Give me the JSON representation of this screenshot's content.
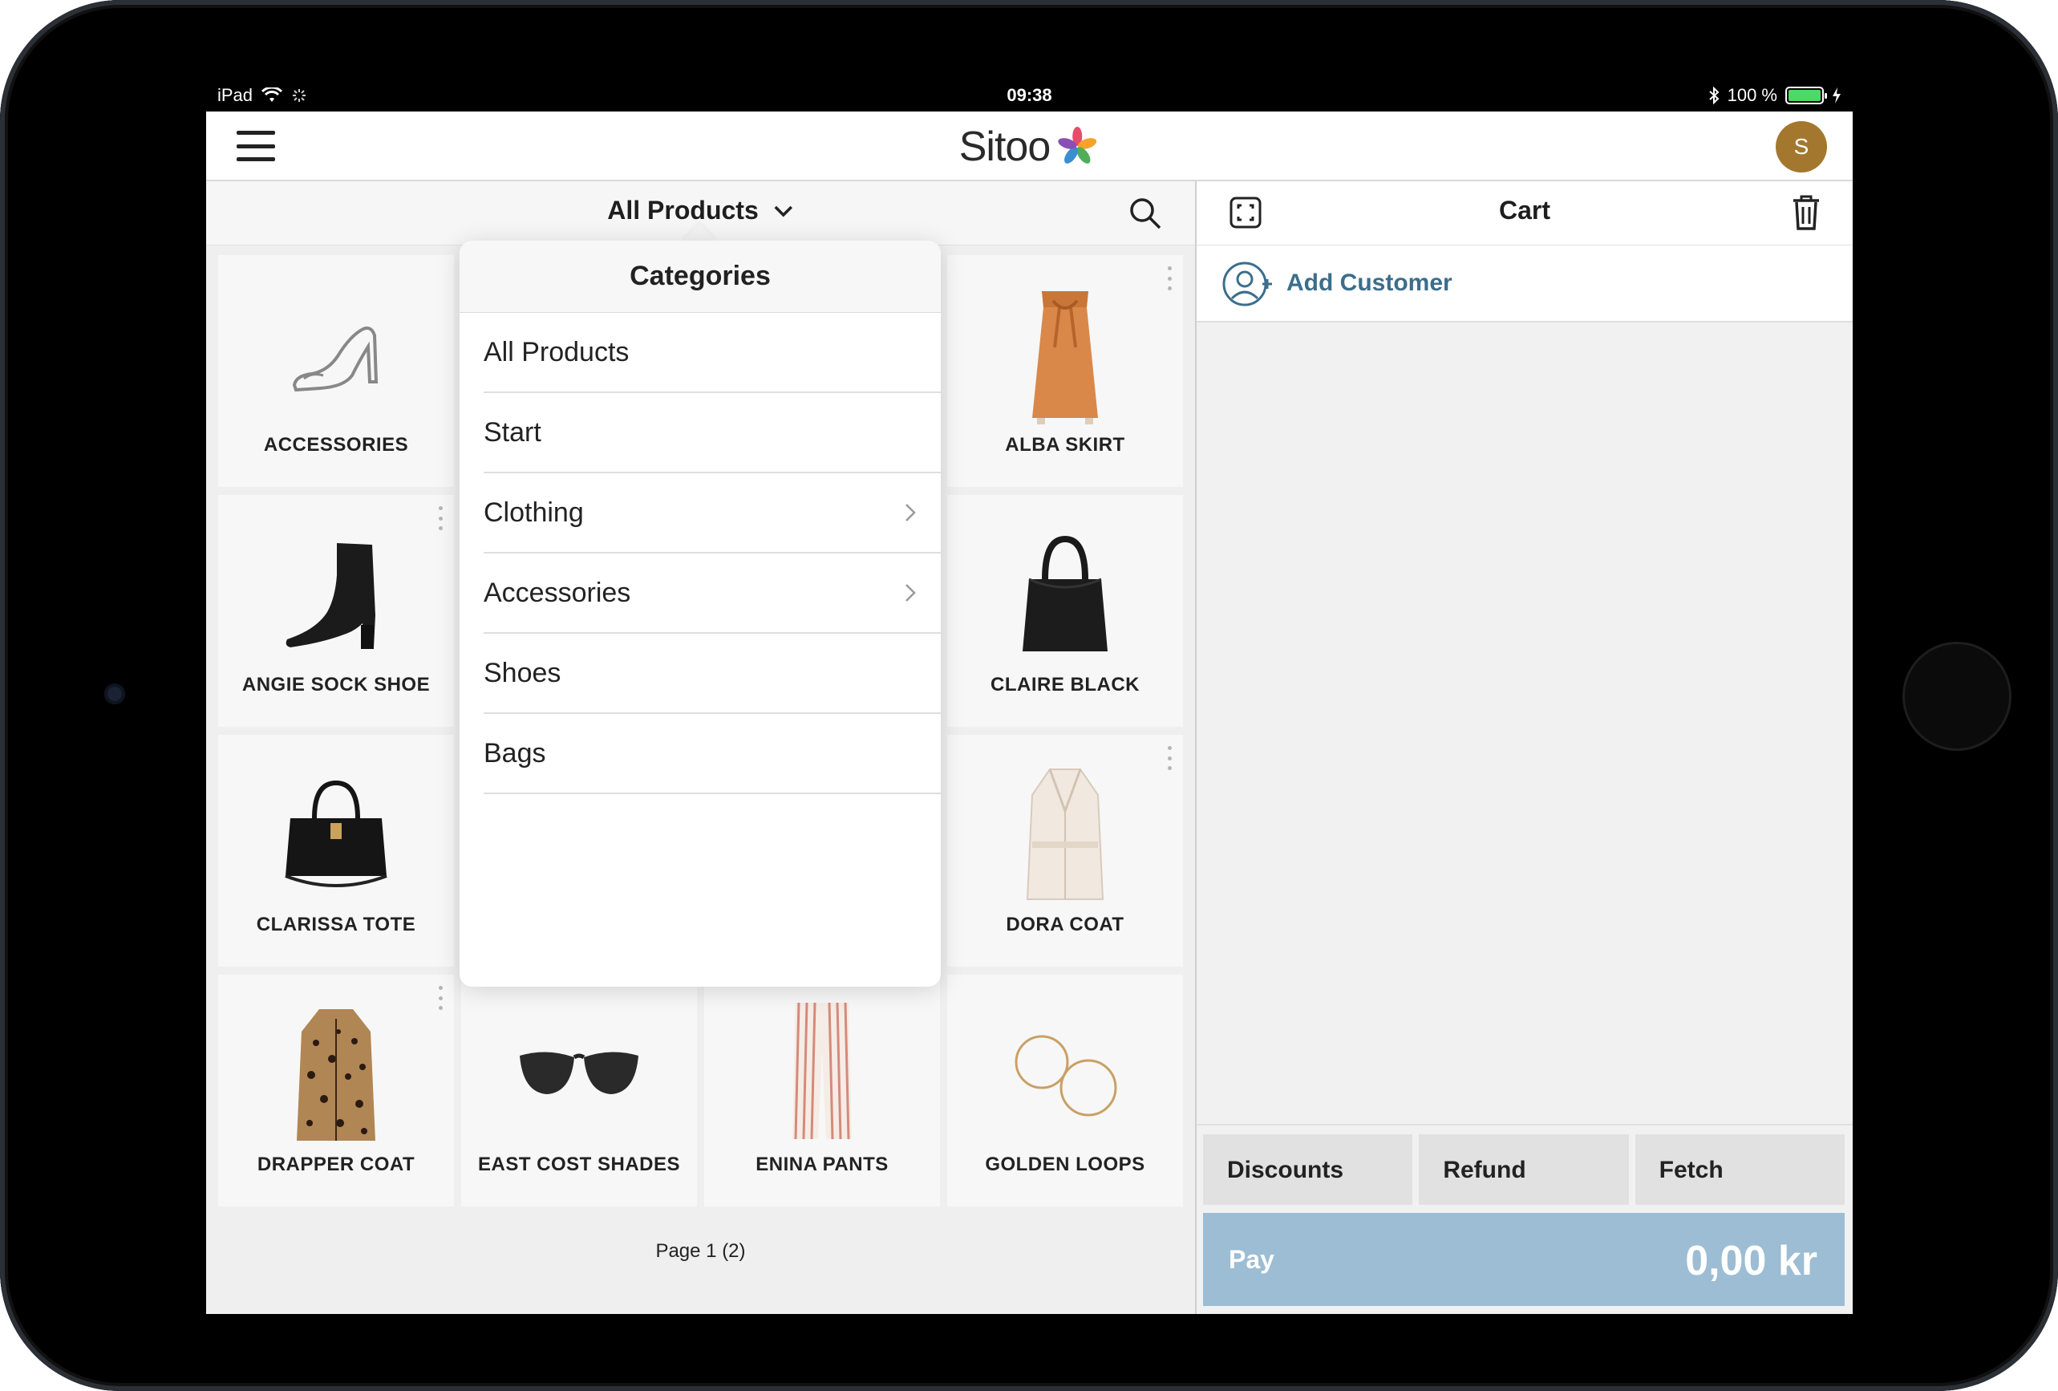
{
  "status_bar": {
    "device": "iPad",
    "time": "09:38",
    "battery": "100 %"
  },
  "header": {
    "logo": "Sitoo",
    "avatar_initial": "S"
  },
  "catalog": {
    "category_select": "All Products",
    "tiles": [
      {
        "label": "ACCESSORIES"
      },
      {
        "label": ""
      },
      {
        "label": ""
      },
      {
        "label": "ALBA SKIRT"
      },
      {
        "label": "ANGIE SOCK SHOE"
      },
      {
        "label": ""
      },
      {
        "label": ""
      },
      {
        "label": "CLAIRE BLACK"
      },
      {
        "label": "CLARISSA TOTE"
      },
      {
        "label": ""
      },
      {
        "label": ""
      },
      {
        "label": "DORA COAT"
      },
      {
        "label": "DRAPPER COAT"
      },
      {
        "label": "EAST COST SHADES"
      },
      {
        "label": "ENINA PANTS"
      },
      {
        "label": "GOLDEN LOOPS"
      }
    ],
    "pager": "Page 1 (2)"
  },
  "categories_menu": {
    "title": "Categories",
    "items": [
      {
        "label": "All Products",
        "has_children": false
      },
      {
        "label": "Start",
        "has_children": false
      },
      {
        "label": "Clothing",
        "has_children": true
      },
      {
        "label": "Accessories",
        "has_children": true
      },
      {
        "label": "Shoes",
        "has_children": false
      },
      {
        "label": "Bags",
        "has_children": false
      }
    ]
  },
  "cart": {
    "title": "Cart",
    "add_customer": "Add Customer",
    "actions": {
      "discounts": "Discounts",
      "refund": "Refund",
      "fetch": "Fetch"
    },
    "pay_label": "Pay",
    "total": "0,00 kr"
  },
  "colors": {
    "accent": "#3c6e8c",
    "pay": "#9cbdd3",
    "avatar": "#a3782e",
    "battery": "#4cd964"
  }
}
